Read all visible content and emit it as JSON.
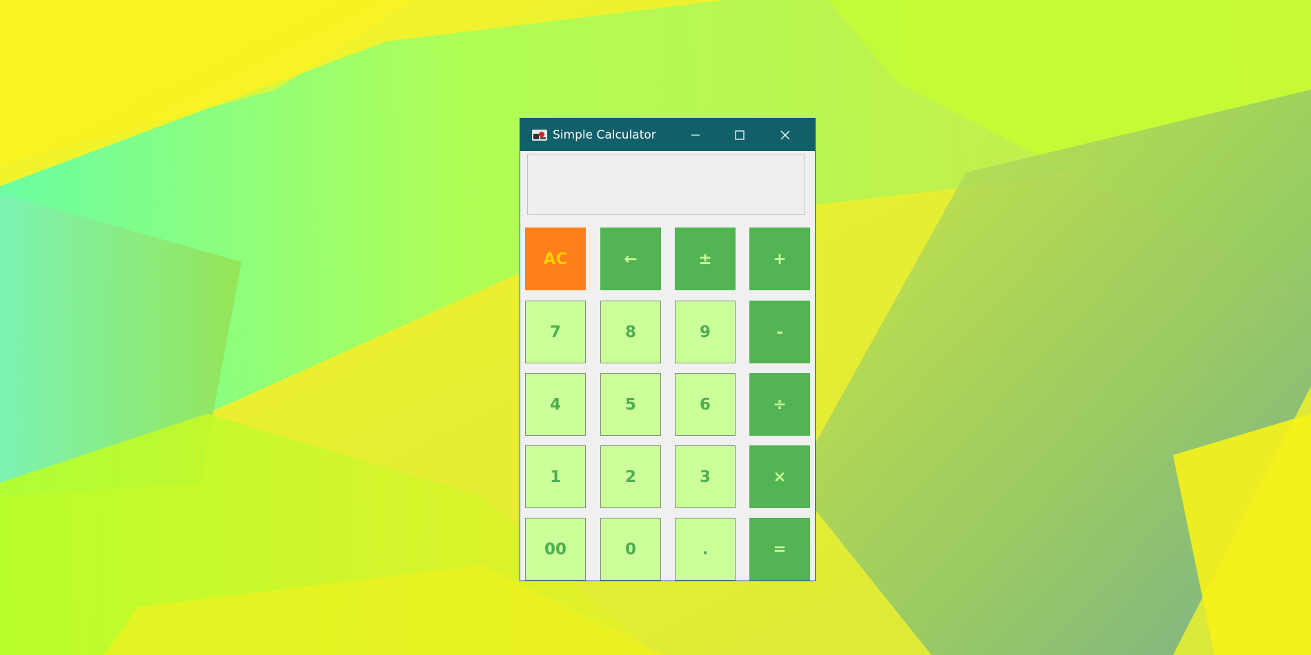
{
  "window": {
    "title": "Simple Calculator",
    "display_value": ""
  },
  "colors": {
    "titlebar": "#115f69",
    "digit_key_bg": "#ccff99",
    "digit_key_text": "#4caf50",
    "op_key_bg": "#52b452",
    "op_key_text": "#ccff99",
    "clear_key_bg": "#ff7f1a",
    "clear_key_text": "#ffd000"
  },
  "icons": {
    "app": "calculator-app-icon",
    "minimize": "minimize-icon",
    "maximize": "maximize-icon",
    "close": "close-icon"
  },
  "keys": {
    "row1": [
      "AC",
      "←",
      "±",
      "+"
    ],
    "row2": [
      "7",
      "8",
      "9",
      "-"
    ],
    "row3": [
      "4",
      "5",
      "6",
      "÷"
    ],
    "row4": [
      "1",
      "2",
      "3",
      "×"
    ],
    "row5": [
      "00",
      "0",
      ".",
      "="
    ]
  }
}
